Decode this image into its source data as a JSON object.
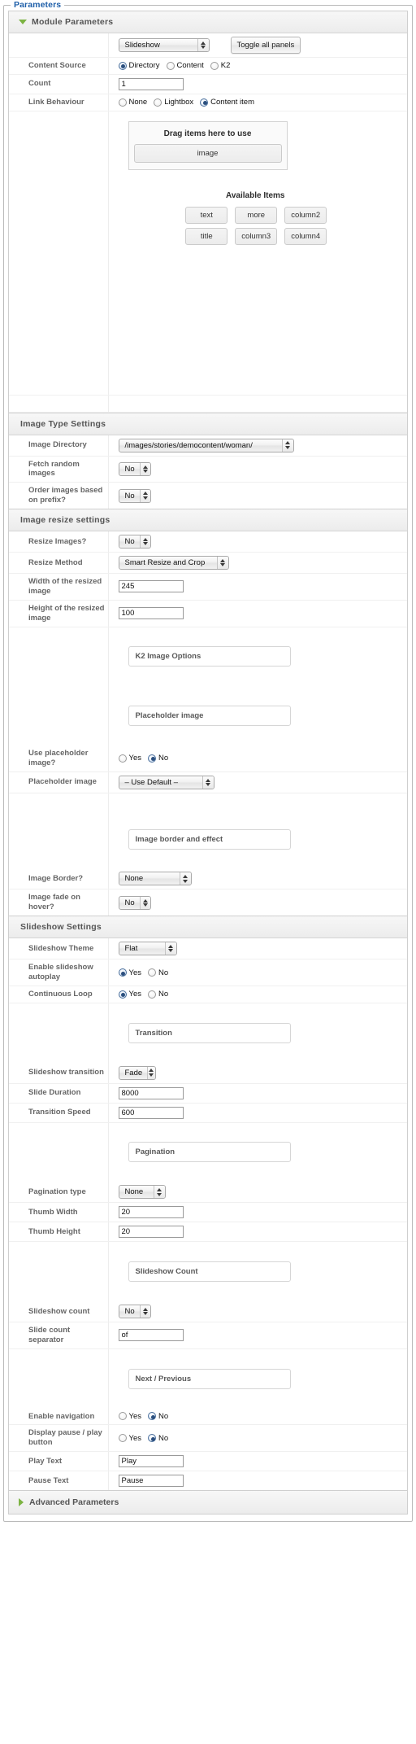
{
  "fieldset": {
    "legend": "Parameters"
  },
  "panels": {
    "module_parameters": {
      "title": "Module Parameters",
      "toggle_button": "Toggle all panels",
      "layout_select": "Slideshow",
      "rows": [
        {
          "label": "Content Source",
          "type": "radio",
          "options": [
            "Directory",
            "Content",
            "K2"
          ],
          "selected": "Directory"
        },
        {
          "label": "Count",
          "type": "text",
          "value": "1"
        },
        {
          "label": "Link Behaviour",
          "type": "radio",
          "options": [
            "None",
            "Lightbox",
            "Content item"
          ],
          "selected": "Content item"
        }
      ],
      "dropzone": {
        "title": "Drag items here to use",
        "items": [
          "image"
        ]
      },
      "available": {
        "title": "Available Items",
        "rows": [
          [
            "text",
            "more",
            "column2"
          ],
          [
            "title",
            "column3",
            "column4"
          ]
        ]
      }
    },
    "image_type_settings": {
      "title": "Image Type Settings",
      "rows": [
        {
          "label": "Image Directory",
          "type": "select",
          "value": "/images/stories/democontent/woman/"
        },
        {
          "label": "Fetch random images",
          "type": "select",
          "value": "No"
        },
        {
          "label": "Order images based on prefix?",
          "type": "select",
          "value": "No"
        }
      ]
    },
    "image_resize_settings": {
      "title": "Image resize settings",
      "rows": [
        {
          "label": "Resize Images?",
          "type": "select",
          "value": "No"
        },
        {
          "label": "Resize Method",
          "type": "select",
          "value": "Smart Resize and Crop"
        },
        {
          "label": "Width of the resized image",
          "type": "text",
          "value": "245"
        },
        {
          "label": "Height of the resized image",
          "type": "text",
          "value": "100"
        }
      ],
      "subheader_k2": "K2 Image Options",
      "subheader_placeholder": "Placeholder image",
      "placeholder_rows": [
        {
          "label": "Use placeholder image?",
          "type": "radio",
          "options": [
            "Yes",
            "No"
          ],
          "selected": "No"
        },
        {
          "label": "Placeholder image",
          "type": "select",
          "value": "– Use Default –"
        }
      ],
      "subheader_border": "Image border and effect",
      "border_rows": [
        {
          "label": "Image Border?",
          "type": "select",
          "value": "None"
        },
        {
          "label": "Image fade on hover?",
          "type": "select",
          "value": "No"
        }
      ]
    },
    "slideshow_settings": {
      "title": "Slideshow Settings",
      "rows": [
        {
          "label": "Slideshow Theme",
          "type": "select",
          "value": "Flat"
        },
        {
          "label": "Enable slideshow autoplay",
          "type": "radio",
          "options": [
            "Yes",
            "No"
          ],
          "selected": "Yes"
        },
        {
          "label": "Continuous Loop",
          "type": "radio",
          "options": [
            "Yes",
            "No"
          ],
          "selected": "Yes"
        }
      ],
      "subheader_transition": "Transition",
      "transition_rows": [
        {
          "label": "Slideshow transition",
          "type": "select",
          "value": "Fade"
        },
        {
          "label": "Slide Duration",
          "type": "text",
          "value": "8000"
        },
        {
          "label": "Transition Speed",
          "type": "text",
          "value": "600"
        }
      ],
      "subheader_pagination": "Pagination",
      "pagination_rows": [
        {
          "label": "Pagination type",
          "type": "select",
          "value": "None"
        },
        {
          "label": "Thumb Width",
          "type": "text",
          "value": "20"
        },
        {
          "label": "Thumb Height",
          "type": "text",
          "value": "20"
        }
      ],
      "subheader_count": "Slideshow Count",
      "count_rows": [
        {
          "label": "Slideshow count",
          "type": "select",
          "value": "No"
        },
        {
          "label": "Slide count separator",
          "type": "text",
          "value": "of"
        }
      ],
      "subheader_nav": "Next / Previous",
      "nav_rows": [
        {
          "label": "Enable navigation",
          "type": "radio",
          "options": [
            "Yes",
            "No"
          ],
          "selected": "No"
        },
        {
          "label": "Display pause / play button",
          "type": "radio",
          "options": [
            "Yes",
            "No"
          ],
          "selected": "No"
        },
        {
          "label": "Play Text",
          "type": "text",
          "value": "Play"
        },
        {
          "label": "Pause Text",
          "type": "text",
          "value": "Pause"
        }
      ]
    },
    "advanced_parameters": {
      "title": "Advanced Parameters"
    }
  },
  "colors": {
    "legend": "#1f5fa9",
    "triangle": "#7cb342",
    "radio_on": "#2b4f7e"
  }
}
